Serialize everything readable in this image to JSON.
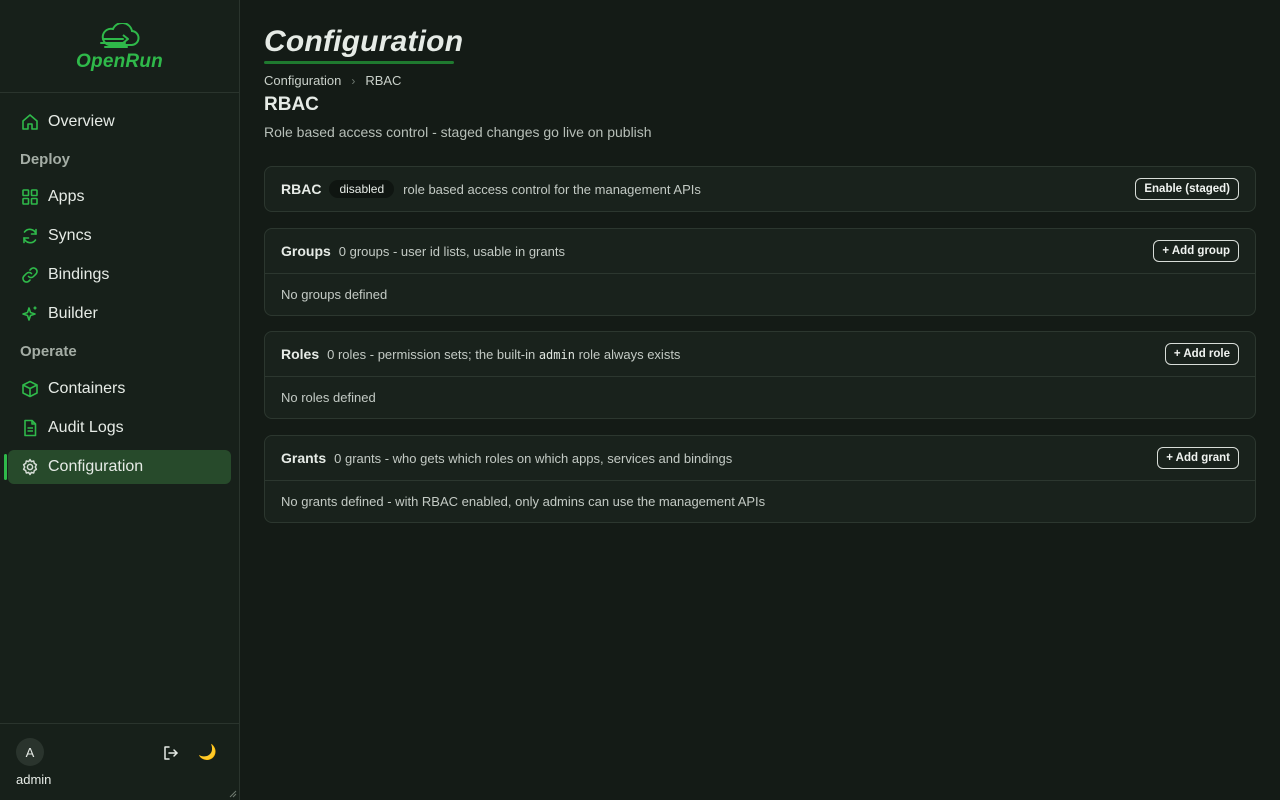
{
  "brand": {
    "name": "OpenRun"
  },
  "sidebar": {
    "items": [
      {
        "label": "Overview",
        "icon": "home-icon"
      },
      {
        "section": "Deploy"
      },
      {
        "label": "Apps",
        "icon": "grid-icon"
      },
      {
        "label": "Syncs",
        "icon": "refresh-icon"
      },
      {
        "label": "Bindings",
        "icon": "link-icon"
      },
      {
        "label": "Builder",
        "icon": "sparkle-icon"
      },
      {
        "section": "Operate"
      },
      {
        "label": "Containers",
        "icon": "cube-icon"
      },
      {
        "label": "Audit Logs",
        "icon": "document-icon"
      },
      {
        "label": "Configuration",
        "icon": "gear-icon",
        "active": true
      }
    ],
    "sections": {
      "deploy": "Deploy",
      "operate": "Operate"
    },
    "overview": "Overview",
    "apps": "Apps",
    "syncs": "Syncs",
    "bindings": "Bindings",
    "builder": "Builder",
    "containers": "Containers",
    "audit_logs": "Audit Logs",
    "configuration": "Configuration"
  },
  "user": {
    "initial": "A",
    "name": "admin"
  },
  "page": {
    "title": "Configuration",
    "breadcrumb": [
      "Configuration",
      "RBAC"
    ],
    "section_title": "RBAC",
    "section_subtitle": "Role based access control - staged changes go live on publish"
  },
  "cards": {
    "rbac": {
      "name": "RBAC",
      "badge": "disabled",
      "desc": "role based access control for the management APIs",
      "button": "Enable (staged)"
    },
    "groups": {
      "name": "Groups",
      "desc": "0 groups - user id lists, usable in grants",
      "button": "+ Add group",
      "empty": "No groups defined"
    },
    "roles": {
      "name": "Roles",
      "desc_before": "0 roles - permission sets; the built-in ",
      "desc_code": "admin",
      "desc_after": " role always exists",
      "button": "+ Add role",
      "empty": "No roles defined"
    },
    "grants": {
      "name": "Grants",
      "desc": "0 grants - who gets which roles on which apps, services and bindings",
      "button": "+ Add grant",
      "empty": "No grants defined - with RBAC enabled, only admins can use the management APIs"
    }
  },
  "colors": {
    "accent": "#2fb94a",
    "active_bg": "#274a2b",
    "background": "#141b16"
  }
}
